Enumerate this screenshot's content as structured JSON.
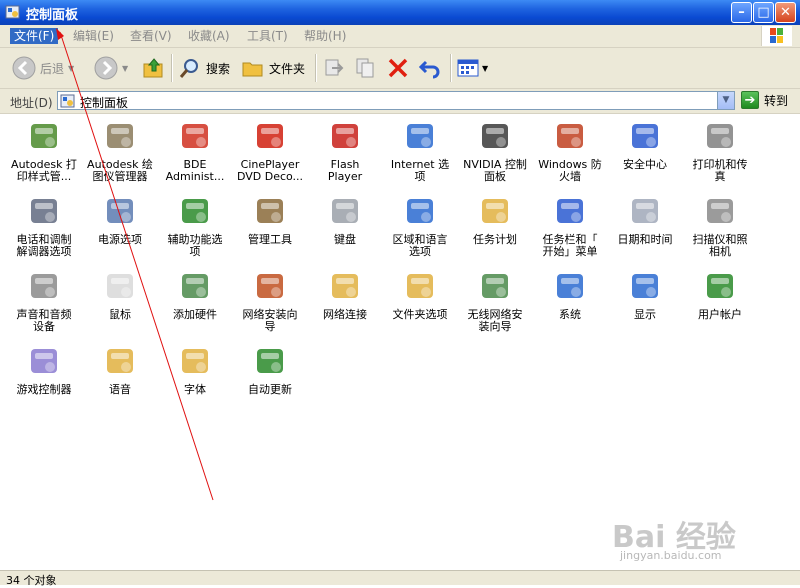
{
  "window": {
    "title": "控制面板"
  },
  "menu": [
    {
      "label": "文件(F)",
      "active": true
    },
    {
      "label": "编辑(E)",
      "active": false
    },
    {
      "label": "查看(V)",
      "active": false
    },
    {
      "label": "收藏(A)",
      "active": false
    },
    {
      "label": "工具(T)",
      "active": false
    },
    {
      "label": "帮助(H)",
      "active": false
    }
  ],
  "toolbar": {
    "back": "后退",
    "search": "搜索",
    "folders": "文件夹"
  },
  "address": {
    "label": "地址(D)",
    "value": "控制面板",
    "go": "转到"
  },
  "items": [
    {
      "label": "Autodesk 打\n印样式管...",
      "icon": "printer-style-icon",
      "color": "#4a8a2a"
    },
    {
      "label": "Autodesk 绘\n图仪管理器",
      "icon": "plotter-icon",
      "color": "#8a7a5a"
    },
    {
      "label": "BDE\nAdminist...",
      "icon": "bde-icon",
      "color": "#d03020"
    },
    {
      "label": "CinePlayer\nDVD Deco...",
      "icon": "cineplayer-icon",
      "color": "#d02010"
    },
    {
      "label": "Flash\nPlayer",
      "icon": "flash-icon",
      "color": "#c8201a"
    },
    {
      "label": "Internet 选\n项",
      "icon": "internet-options-icon",
      "color": "#2a6ad0"
    },
    {
      "label": "NVIDIA 控制\n面板",
      "icon": "nvidia-icon",
      "color": "#3a3a3a"
    },
    {
      "label": "Windows 防\n火墙",
      "icon": "firewall-icon",
      "color": "#c04020"
    },
    {
      "label": "安全中心",
      "icon": "security-center-icon",
      "color": "#2a5ad0"
    },
    {
      "label": "打印机和传\n真",
      "icon": "printer-fax-icon",
      "color": "#808080"
    },
    {
      "label": "电话和调制\n解调器选项",
      "icon": "phone-modem-icon",
      "color": "#606a80"
    },
    {
      "label": "电源选项",
      "icon": "power-icon",
      "color": "#5a7ab0"
    },
    {
      "label": "辅助功能选\n项",
      "icon": "accessibility-icon",
      "color": "#2a8a2a"
    },
    {
      "label": "管理工具",
      "icon": "admin-tools-icon",
      "color": "#8a6a3a"
    },
    {
      "label": "键盘",
      "icon": "keyboard-icon",
      "color": "#9aa0a8"
    },
    {
      "label": "区域和语言\n选项",
      "icon": "region-language-icon",
      "color": "#2a6ad0"
    },
    {
      "label": "任务计划",
      "icon": "scheduled-tasks-icon",
      "color": "#e0b040"
    },
    {
      "label": "任务栏和「\n开始」菜单",
      "icon": "taskbar-icon",
      "color": "#2a5ad0"
    },
    {
      "label": "日期和时间",
      "icon": "date-time-icon",
      "color": "#a0a8b8"
    },
    {
      "label": "扫描仪和照\n相机",
      "icon": "scanner-camera-icon",
      "color": "#8a8a8a"
    },
    {
      "label": "声音和音频\n设备",
      "icon": "sound-icon",
      "color": "#8a8a8a"
    },
    {
      "label": "鼠标",
      "icon": "mouse-icon",
      "color": "#d8d8d8"
    },
    {
      "label": "添加硬件",
      "icon": "add-hardware-icon",
      "color": "#4a8a4a"
    },
    {
      "label": "网络安装向\n导",
      "icon": "network-setup-icon",
      "color": "#c05020"
    },
    {
      "label": "网络连接",
      "icon": "network-connections-icon",
      "color": "#e0b040"
    },
    {
      "label": "文件夹选项",
      "icon": "folder-options-icon",
      "color": "#e0b040"
    },
    {
      "label": "无线网络安\n装向导",
      "icon": "wireless-setup-icon",
      "color": "#4a8a4a"
    },
    {
      "label": "系统",
      "icon": "system-icon",
      "color": "#2a6ad0"
    },
    {
      "label": "显示",
      "icon": "display-icon",
      "color": "#2a6ad0"
    },
    {
      "label": "用户帐户",
      "icon": "user-accounts-icon",
      "color": "#2a8a2a"
    },
    {
      "label": "游戏控制器",
      "icon": "game-controller-icon",
      "color": "#8a7ad0"
    },
    {
      "label": "语音",
      "icon": "speech-icon",
      "color": "#e0b040"
    },
    {
      "label": "字体",
      "icon": "fonts-icon",
      "color": "#e0b040"
    },
    {
      "label": "自动更新",
      "icon": "automatic-updates-icon",
      "color": "#2a8a2a"
    }
  ],
  "status": {
    "text": "34 个对象"
  },
  "watermark": {
    "brand": "Bai 经验",
    "url": "jingyan.baidu.com"
  }
}
